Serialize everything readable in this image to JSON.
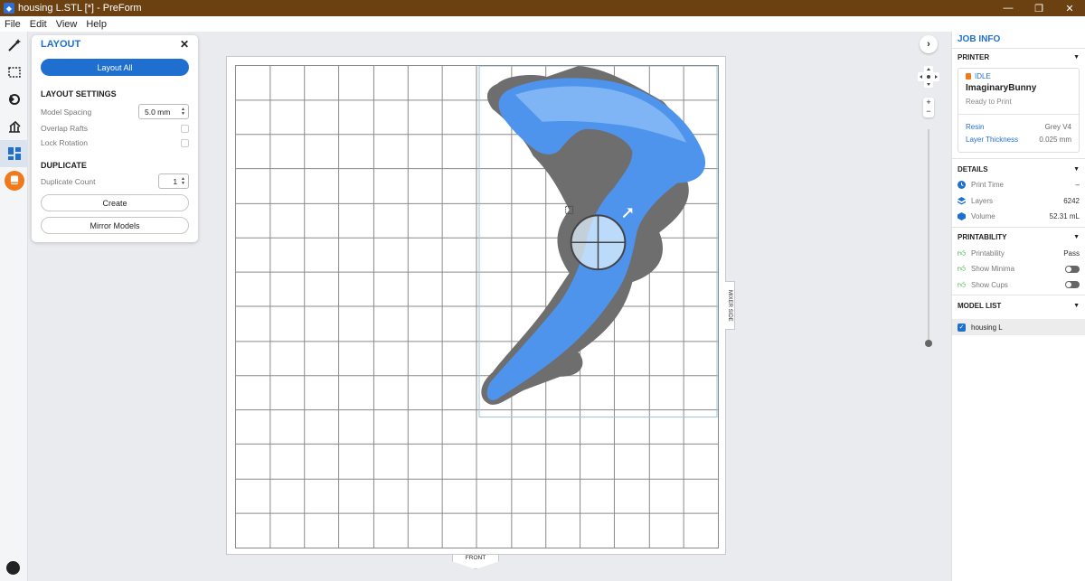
{
  "window": {
    "title": "housing L.STL [*] - PreForm",
    "minimize": "—",
    "maximize": "❐",
    "close": "✕"
  },
  "menu": [
    "File",
    "Edit",
    "View",
    "Help"
  ],
  "layout_panel": {
    "title": "LAYOUT",
    "close": "✕",
    "layout_all": "Layout All",
    "settings_title": "LAYOUT SETTINGS",
    "model_spacing_label": "Model Spacing",
    "model_spacing_value": "5.0 mm",
    "overlap_rafts_label": "Overlap Rafts",
    "lock_rotation_label": "Lock Rotation",
    "duplicate_title": "DUPLICATE",
    "duplicate_count_label": "Duplicate Count",
    "duplicate_count_value": "1",
    "create": "Create",
    "mirror": "Mirror Models"
  },
  "viewport": {
    "front_label": "FRONT",
    "side_label": "MIXER SIDE",
    "zoom_in": "+",
    "zoom_out": "−",
    "expand": "›"
  },
  "job_info": {
    "title": "JOB INFO",
    "printer_section": "PRINTER",
    "printer_status": "IDLE",
    "printer_name": "ImaginaryBunny",
    "printer_state": "Ready to Print",
    "resin_label": "Resin",
    "resin_value": "Grey V4",
    "layer_thickness_label": "Layer Thickness",
    "layer_thickness_value": "0.025 mm",
    "details_section": "DETAILS",
    "print_time_label": "Print Time",
    "print_time_value": "–",
    "layers_label": "Layers",
    "layers_value": "6242",
    "volume_label": "Volume",
    "volume_value": "52.31 mL",
    "printability_section": "PRINTABILITY",
    "printability_label": "Printability",
    "printability_value": "Pass",
    "show_minima_label": "Show Minima",
    "show_cups_label": "Show Cups",
    "model_list_section": "MODEL LIST",
    "model_name": "housing L"
  },
  "colors": {
    "accent": "#1f6fd1",
    "titlebar": "#6b4112",
    "model": "#4f94ec",
    "support": "#6e6e6e"
  }
}
